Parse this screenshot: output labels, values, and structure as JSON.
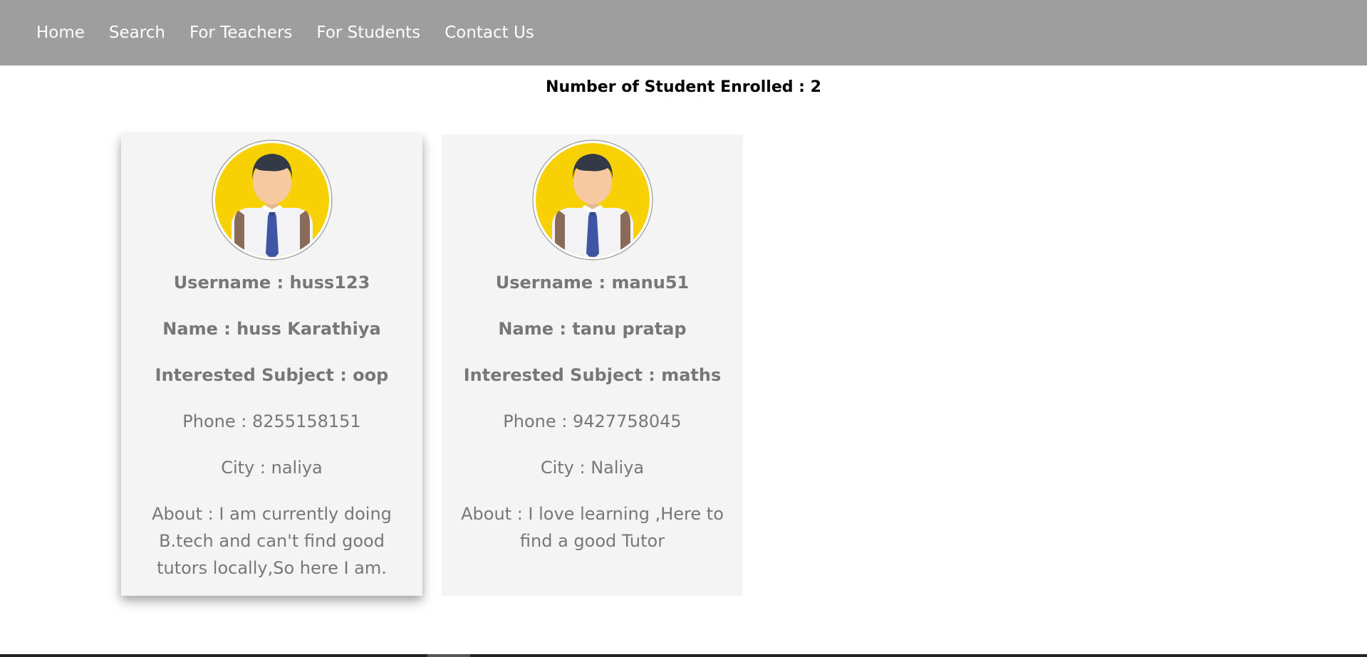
{
  "nav": {
    "items": [
      {
        "label": "Home"
      },
      {
        "label": "Search"
      },
      {
        "label": "For Teachers"
      },
      {
        "label": "For Students"
      },
      {
        "label": "Contact Us"
      }
    ]
  },
  "enrolled_text": "Number of Student Enrolled : 2",
  "students": [
    {
      "avatar_icon": "student-avatar-icon",
      "username": "Username : huss123",
      "name": "Name : huss Karathiya",
      "subject": "Interested Subject : oop",
      "phone": "Phone : 8255158151",
      "city": "City : naliya",
      "about": "About : I am currently doing B.tech and can't find good tutors locally,So here I am."
    },
    {
      "avatar_icon": "student-avatar-icon",
      "username": "Username : manu51",
      "name": "Name : tanu pratap",
      "subject": "Interested Subject : maths",
      "phone": "Phone : 9427758045",
      "city": "City : Naliya",
      "about": "About : I love learning ,Here to find a good Tutor"
    }
  ],
  "colors": {
    "navbar": "#9e9e9e",
    "card": "#f4f4f4",
    "text_muted": "#777777",
    "avatar_bg": "#f7d104"
  }
}
